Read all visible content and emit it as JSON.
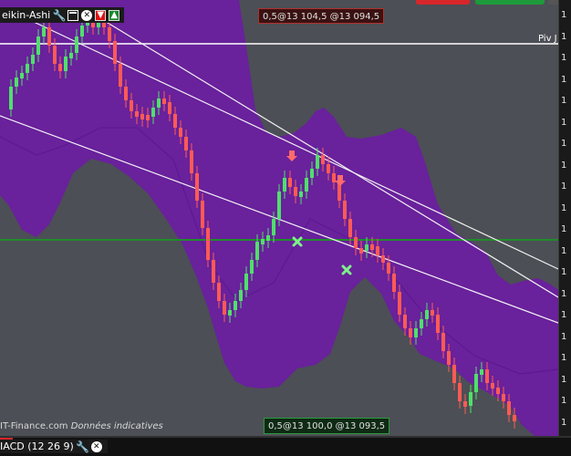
{
  "window": {
    "title": "eikin-Ashi",
    "indicator_title": "IACD (12 26 9)"
  },
  "chart": {
    "pivot_label": "Piv J",
    "badge_top": "0,5@13 104,5 @13 094,5",
    "badge_bottom_left": "0,5@13 100,0",
    "badge_bottom_right": "@13 093,5",
    "credit_source": "IT-Finance.com",
    "credit_note": "Données indicatives",
    "axis_ticks": [
      "1",
      "1",
      "1",
      "1",
      "1",
      "1",
      "1",
      "1",
      "1",
      "1",
      "1",
      "1",
      "1",
      "1",
      "1",
      "1",
      "1",
      "1",
      "1",
      "1"
    ],
    "colors": {
      "background": "#4c4f55",
      "band_fill": "#6a1fa0",
      "bull_candle": "#4ee06a",
      "bear_candle": "#ff5a55",
      "pivot_line": "#ffffff",
      "support_line": "#1f8c2a"
    },
    "icons": [
      "wrench-icon",
      "window-icon",
      "close-icon",
      "arrow-down-icon",
      "arrow-up-icon"
    ]
  }
}
